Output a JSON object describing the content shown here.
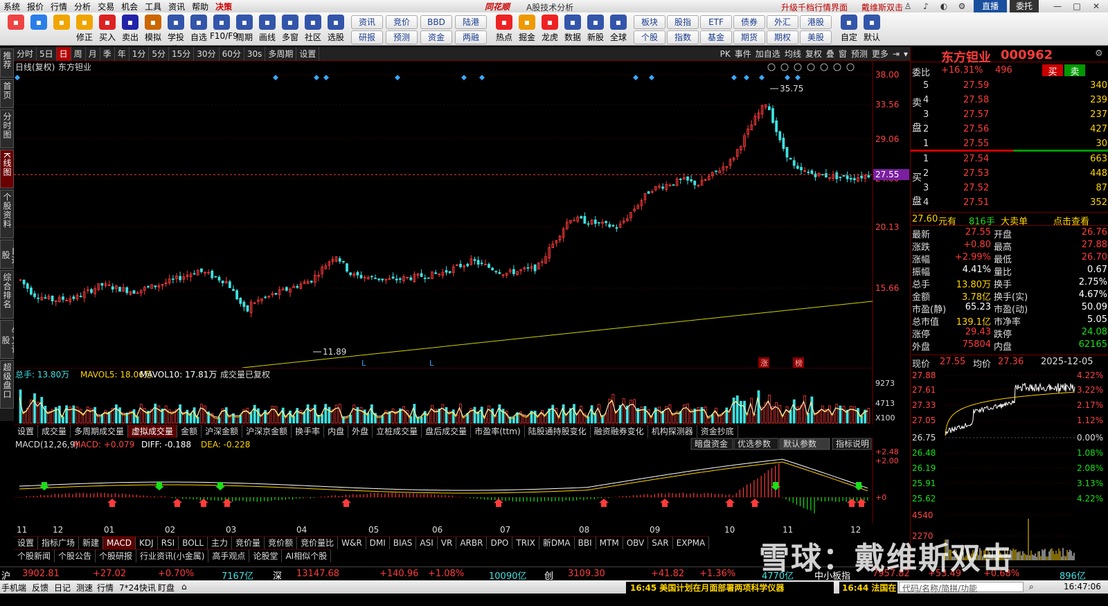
{
  "menubar": {
    "items": [
      "系统",
      "报价",
      "行情",
      "分析",
      "交易",
      "机会",
      "工具",
      "资讯",
      "帮助"
    ],
    "warn": "决策",
    "brand": "同花顺",
    "subtitle": "A股技术分析",
    "link1": "升级千档行情界面",
    "link2": "戴维斯双击",
    "live": "直播",
    "entrust": "委托"
  },
  "toolbar": {
    "buttons": [
      {
        "label": "",
        "icon": "grid-icon",
        "color": "#e44"
      },
      {
        "label": "",
        "icon": "ai-icon",
        "color": "#2a7ee8"
      },
      {
        "label": "",
        "icon": "back-arrow-icon",
        "color": "#f0a500"
      },
      {
        "label": "修正",
        "icon": "up-down-icon",
        "color": "#f0a500"
      },
      {
        "label": "买入",
        "icon": "buy-icon",
        "color": "#d22"
      },
      {
        "label": "卖出",
        "icon": "sell-icon",
        "color": "#22a"
      },
      {
        "label": "模拟",
        "icon": "hammer-icon",
        "color": "#c60"
      },
      {
        "label": "学投资",
        "icon": "cap-icon",
        "color": "#35a"
      },
      {
        "label": "自选",
        "icon": "star-icon",
        "color": "#35a"
      },
      {
        "label": "F10/F9",
        "icon": "f10-icon",
        "color": "#35a"
      },
      {
        "label": "周期",
        "icon": "clock-icon",
        "color": "#35a"
      },
      {
        "label": "画线",
        "icon": "pen-icon",
        "color": "#35a"
      },
      {
        "label": "多窗",
        "icon": "window-icon",
        "color": "#35a"
      },
      {
        "label": "社区",
        "icon": "community-icon",
        "color": "#35a"
      },
      {
        "label": "选股",
        "icon": "search-chart-icon",
        "color": "#35a"
      }
    ],
    "small_buttons": [
      [
        "资讯",
        "研报"
      ],
      [
        "竞价",
        "预测"
      ],
      [
        "BBD",
        "资金"
      ],
      [
        "陆港",
        "两融"
      ]
    ],
    "buttons2": [
      {
        "label": "热点",
        "icon": "hot-icon",
        "color": "#e22"
      },
      {
        "label": "掘金",
        "icon": "gold-icon",
        "color": "#e90"
      },
      {
        "label": "龙虎",
        "icon": "dragon-icon",
        "color": "#e22"
      },
      {
        "label": "数据",
        "icon": "pe-icon",
        "color": "#35a"
      },
      {
        "label": "新股",
        "icon": "ipo-icon",
        "color": "#35a"
      },
      {
        "label": "全球",
        "icon": "globe-icon",
        "color": "#35a"
      }
    ],
    "small_buttons2": [
      [
        "板块",
        "个股"
      ],
      [
        "股指",
        "指数"
      ],
      [
        "ETF",
        "基金"
      ],
      [
        "债券",
        "期货"
      ],
      [
        "外汇",
        "期权"
      ],
      [
        "港股",
        "美股"
      ]
    ],
    "buttons3": [
      {
        "label": "自定",
        "icon": "custom-icon",
        "color": "#35a"
      },
      {
        "label": "默认",
        "icon": "home-icon",
        "color": "#35a"
      }
    ]
  },
  "lefttabs": [
    "推荐",
    "首页",
    "分时图",
    "K线图",
    "个股资料",
    "自选股",
    "综合排名",
    "牛叉诊股",
    "超级盘口"
  ],
  "periodbar": {
    "items": [
      "分时",
      "5日",
      "日",
      "周",
      "月",
      "季",
      "年",
      "1分",
      "5分",
      "15分",
      "30分",
      "60分",
      "30s",
      "多周期",
      "设置"
    ],
    "selected": "日",
    "right": [
      "PK",
      "事件",
      "加自选",
      "均线",
      "复权",
      "叠",
      "窗",
      "预测",
      "更多"
    ]
  },
  "kline": {
    "title": "日线(复权)",
    "name": "东方钽业",
    "yaxis": [
      "38.00",
      "33.56",
      "29.06",
      "24.60",
      "20.13",
      "15.66"
    ],
    "current": "27.55",
    "high_label": "35.75",
    "low_label": "11.89",
    "marks": [
      "L",
      "L",
      "涨",
      "榜"
    ]
  },
  "volume": {
    "label": "总手: 13.80万",
    "mavol5": "MAVOL5: 18.06万",
    "mavol10": "MAVOL10: 17.81万",
    "restored": "成交量已复权",
    "yaxis": [
      "9273",
      "4713",
      "X100"
    ]
  },
  "subtabs1": [
    "设置",
    "成交量",
    "多周期成交量",
    "虚拟成交量",
    "金额",
    "沪深金额",
    "沪深京金额",
    "换手率",
    "内盘",
    "外盘",
    "立桩成交量",
    "盘后成交量",
    "市盈率(ttm)",
    "陆股通持股变化",
    "融资融券变化",
    "机构探测器",
    "资金抄底"
  ],
  "subtabs1_selected": "虚拟成交量",
  "macd": {
    "label": "MACD(12,26,9)",
    "macd": "MACD: +0.079",
    "diff": "DIFF: -0.188",
    "dea": "DEA: -0.228",
    "yaxis": [
      "+2.48",
      "+2.00",
      "+0"
    ],
    "buttons": [
      "暗盘资金",
      "优选参数",
      "默认参数",
      "指标说明"
    ]
  },
  "xaxis": [
    "11",
    "12",
    "01",
    "02",
    "03",
    "04",
    "05",
    "06",
    "07",
    "08",
    "09",
    "10",
    "11",
    "12"
  ],
  "subtabs2": [
    "设置",
    "指标广场",
    "新建",
    "MACD",
    "KDJ",
    "RSI",
    "BOLL",
    "主力",
    "竞价量",
    "竞价额",
    "竞价量比",
    "W&R",
    "DMI",
    "BIAS",
    "ASI",
    "VR",
    "ARBR",
    "DPO",
    "TRIX",
    "新DMA",
    "BBI",
    "MTM",
    "OBV",
    "SAR",
    "EXPMA"
  ],
  "subtabs2_selected": "MACD",
  "subtabs3": [
    "个股新闻",
    "个股公告",
    "个股研报",
    "行业资讯(小金属)",
    "高手观点",
    "论股堂",
    "AI相似个股"
  ],
  "quote": {
    "name": "东方钽业",
    "code": "000962",
    "weibi_label": "委比",
    "weibi": "+16.31%",
    "weicha": "496",
    "buy": "买",
    "sell": "卖",
    "sell_label": [
      "卖",
      "盘"
    ],
    "buy_label": [
      "买",
      "盘"
    ],
    "asks": [
      {
        "n": "5",
        "p": "27.59",
        "v": "340"
      },
      {
        "n": "4",
        "p": "27.58",
        "v": "239"
      },
      {
        "n": "3",
        "p": "27.57",
        "v": "237"
      },
      {
        "n": "2",
        "p": "27.56",
        "v": "427"
      },
      {
        "n": "1",
        "p": "27.55",
        "v": "30"
      }
    ],
    "bids": [
      {
        "n": "1",
        "p": "27.54",
        "v": "663"
      },
      {
        "n": "2",
        "p": "27.53",
        "v": "448"
      },
      {
        "n": "3",
        "p": "27.52",
        "v": "87"
      },
      {
        "n": "4",
        "p": "27.51",
        "v": "352"
      }
    ],
    "bigorder": {
      "price": "27.60",
      "unit": "元有",
      "qty": "816手",
      "text": "大卖单",
      "link": "点击查看"
    },
    "stats": [
      [
        "最新",
        "27.55",
        "开盘",
        "26.76"
      ],
      [
        "涨跌",
        "+0.80",
        "最高",
        "27.88"
      ],
      [
        "涨幅",
        "+2.99%",
        "最低",
        "26.70"
      ],
      [
        "振幅",
        "4.41%",
        "量比",
        "0.67"
      ],
      [
        "总手",
        "13.80万",
        "换手",
        "2.75%"
      ],
      [
        "金额",
        "3.78亿",
        "换手(实)",
        "4.67%"
      ],
      [
        "市盈(静)",
        "65.23",
        "市盈(动)",
        "50.09"
      ],
      [
        "总市值",
        "139.1亿",
        "市净率",
        "5.05"
      ],
      [
        "涨停",
        "29.43",
        "跌停",
        "24.08"
      ],
      [
        "外盘",
        "75804",
        "内盘",
        "62165"
      ]
    ],
    "intraday": {
      "now_label": "现价",
      "now": "27.55",
      "avg_label": "均价",
      "avg": "27.36",
      "date": "2025-12-05",
      "left_axis": [
        "27.88",
        "27.61",
        "27.33",
        "27.05",
        "26.75",
        "26.48",
        "26.19",
        "25.91",
        "25.62",
        "4540",
        "2270"
      ],
      "right_axis": [
        "4.22%",
        "3.22%",
        "2.17%",
        "1.12%",
        "0.00%",
        "1.08%",
        "2.08%",
        "3.13%",
        "4.22%"
      ]
    }
  },
  "bottombar": {
    "sh_label": "沪",
    "sh": "3902.81",
    "sh_chg": "+27.02",
    "sh_pct": "+0.70%",
    "sh_amt": "7167亿",
    "sz_label": "深",
    "sz": "13147.68",
    "sz_chg": "+140.96",
    "sz_pct": "+1.08%",
    "sz_amt": "10090亿",
    "cy_label": "创",
    "cy": "3109.30",
    "cy_chg": "+41.82",
    "cy_pct": "+1.36%",
    "cy_amt": "4770亿",
    "zx_label": "中小板指",
    "zx": "7957.82",
    "zx_chg": "+53.49",
    "zx_pct": "+0.68%",
    "zx_amt": "896亿"
  },
  "statusbar": {
    "items": [
      "手机端",
      "反馈",
      "日记",
      "测速",
      "行情",
      "7*24快讯",
      "盯盘"
    ],
    "news1": "16:45 美国计划在月面部署两项科学仪器",
    "news2": "16:44 法国在",
    "search": "代码/名称/简拼/功能",
    "time": "16:47:06"
  },
  "watermark": "雪球：戴维斯双击",
  "colors": {
    "up": "#ff3b3b",
    "down": "#3fe0e0",
    "ma_yellow": "#ffd400",
    "bg": "#000000"
  }
}
